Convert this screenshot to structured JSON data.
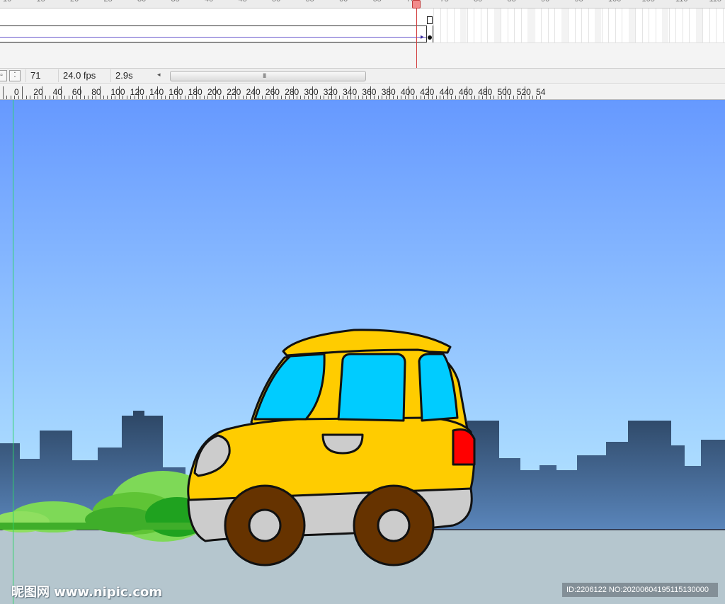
{
  "timeline": {
    "frame_numbers": [
      "10",
      "15",
      "20",
      "25",
      "30",
      "35",
      "40",
      "45",
      "50",
      "55",
      "60",
      "65",
      "70",
      "75",
      "80",
      "85",
      "90",
      "95",
      "100",
      "105",
      "110",
      "115"
    ],
    "current_frame_marker": "71"
  },
  "statusbar": {
    "current_frame": "71",
    "frame_rate": "24.0 fps",
    "elapsed_time": "2.9s",
    "scroll_left_glyph": "◂",
    "scroll_grip_glyph": "III"
  },
  "stage_ruler": {
    "labels": [
      "0",
      "20",
      "40",
      "60",
      "80",
      "100",
      "120",
      "140",
      "160",
      "180",
      "200",
      "220",
      "240",
      "260",
      "280",
      "300",
      "320",
      "340",
      "360",
      "380",
      "400",
      "420",
      "440",
      "460",
      "480",
      "500",
      "520",
      "54"
    ]
  },
  "stage": {
    "sky_top_color": "#6699ff",
    "sky_bottom_color": "#b8e8ff",
    "ground_color": "#b5c6ce",
    "city_color": "#2f4a68",
    "car_body_color": "#ffcc00",
    "car_window_color": "#00ccff",
    "tail_light_color": "#ff0000",
    "wheel_color": "#663300",
    "bush_color": "#5fc435"
  },
  "watermark": {
    "site": "昵图网 www.nipic.com",
    "id_text": "ID:2206122 NO:20200604195115130000"
  }
}
